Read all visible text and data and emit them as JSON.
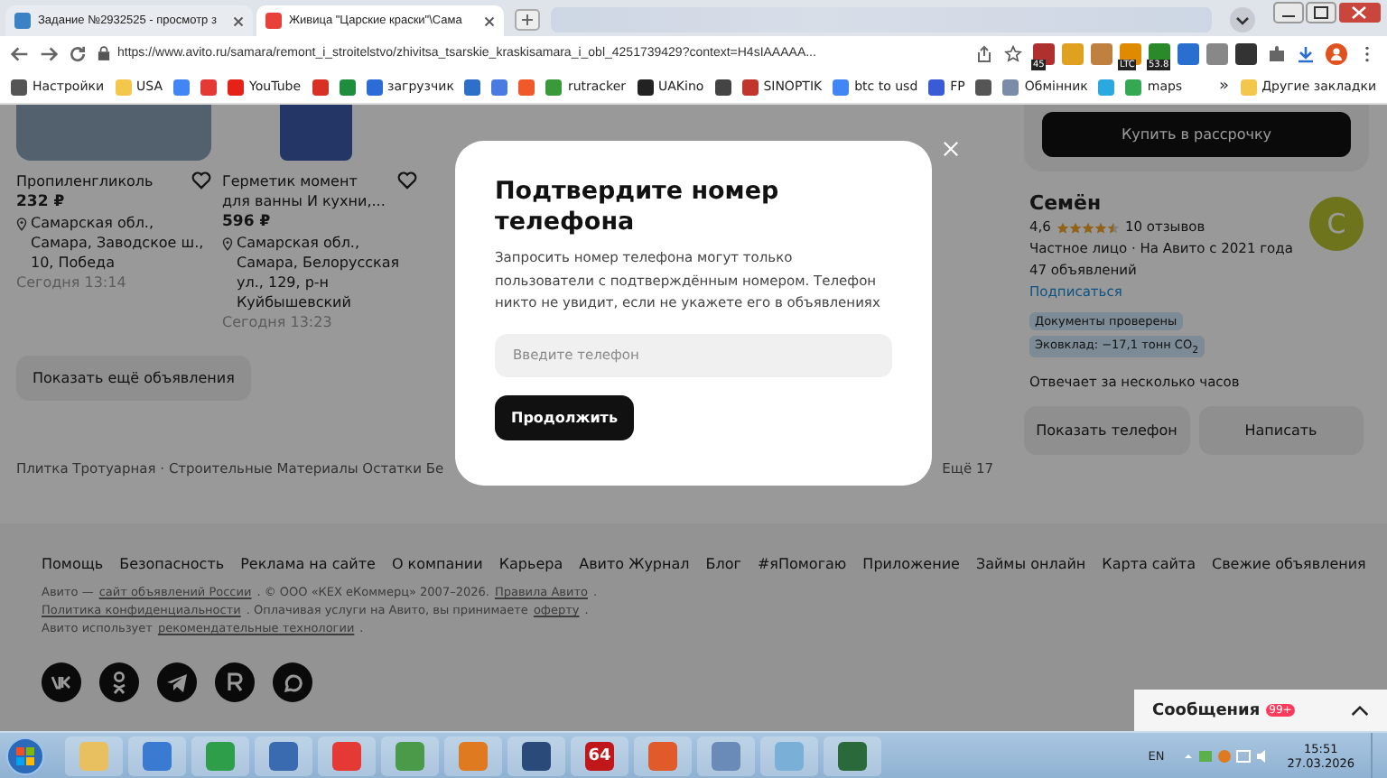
{
  "browser": {
    "tabs": [
      {
        "label": "Задание №2932525 - просмотр з",
        "selected": false,
        "color": "#3b82c4"
      },
      {
        "label": "Живица \"Царские краски\"\\Сама",
        "selected": true,
        "color": "#e8413c"
      }
    ],
    "url": "https://www.avito.ru/samara/remont_i_stroitelstvo/zhivitsa_tsarskie_kraskisamara_i_obl_4251739429?context=H4sIAAAAA...",
    "extensions": [
      {
        "color": "#b03030",
        "badge": "45"
      },
      {
        "color": "#e0a020"
      },
      {
        "color": "#c08040"
      },
      {
        "color": "#e08a00",
        "badge": "LTC"
      },
      {
        "color": "#2a8a2a",
        "badge": "53.8"
      },
      {
        "color": "#2a6fd0"
      },
      {
        "color": "#888888"
      },
      {
        "color": "#333333"
      }
    ],
    "bookmarks": [
      {
        "label": "Настройки",
        "color": "#555555"
      },
      {
        "label": "USA",
        "color": "#f3c74b"
      },
      {
        "color": "#4285f4"
      },
      {
        "color": "#e53935"
      },
      {
        "label": "YouTube",
        "color": "#e62117"
      },
      {
        "color": "#d93025"
      },
      {
        "color": "#1e8e3e"
      },
      {
        "label": "загрузчик",
        "color": "#2b6cd6"
      },
      {
        "color": "#2d6fc9"
      },
      {
        "color": "#4a7be0"
      },
      {
        "color": "#f0592a"
      },
      {
        "label": "rutracker",
        "color": "#3a9a3a"
      },
      {
        "label": "UAKino",
        "color": "#222222"
      },
      {
        "color": "#444444"
      },
      {
        "label": "SINOPTIK",
        "color": "#c0352c"
      },
      {
        "label": "btc to usd",
        "color": "#4285f4"
      },
      {
        "label": "FP",
        "color": "#3b5bd6"
      },
      {
        "color": "#555555"
      },
      {
        "label": "Обмінник",
        "color": "#7a8ca8"
      },
      {
        "color": "#2aa8e0"
      },
      {
        "label": "maps",
        "color": "#34a853"
      }
    ],
    "more": "»",
    "other_bookmarks": "Другие закладки"
  },
  "page": {
    "listings": [
      {
        "title": "Пропиленгликоль",
        "price": "232 ₽",
        "address": "Самарская обл., Самара, Заводское ш., 10, Победа",
        "date": "Сегодня 13:14"
      },
      {
        "title": "Герметик момент для ванны И кухни,...",
        "price": "596 ₽",
        "address": "Самарская обл., Самара, Белорусская ул., 129, р-н Куйбышевский",
        "date": "Сегодня 13:23"
      }
    ],
    "show_more": "Показать ещё объявления",
    "categories": "Плитка Тротуарная · Строительные Материалы Остатки Бе",
    "categories_more": "Ещё 17",
    "installment_button": "Купить в рассрочку",
    "seller": {
      "name": "Семён",
      "avatar_letter": "С",
      "rating": "4,6",
      "stars": 4.5,
      "reviews": "10 отзывов",
      "info": "Частное лицо · На Авито с 2021 года",
      "listings_count": "47 объявлений",
      "subscribe": "Подписаться",
      "tags": [
        "Документы проверены",
        "Эковклад: −17,1 тонн CO$_{2}$"
      ],
      "response": "Отвечает за несколько часов",
      "phone_button": "Показать телефон",
      "message_button": "Написать"
    },
    "footer": {
      "links": [
        "Помощь",
        "Безопасность",
        "Реклама на сайте",
        "О компании",
        "Карьера",
        "Авито Журнал",
        "Блог",
        "#яПомогаю",
        "Приложение",
        "Займы онлайн",
        "Карта сайта",
        "Свежие объявления"
      ],
      "legal": [
        [
          {
            "kind": "text",
            "text": "Авито —"
          },
          {
            "kind": "link",
            "text": "сайт объявлений России"
          },
          {
            "kind": "text",
            "text": ". © ООО «КЕХ еКоммерц» 2007–2026."
          },
          {
            "kind": "link",
            "text": "Правила Авито"
          },
          {
            "kind": "text",
            "text": "."
          }
        ],
        [
          {
            "kind": "link",
            "text": "Политика конфиденциальности"
          },
          {
            "kind": "text",
            "text": ". Оплачивая услуги на Авито, вы принимаете"
          },
          {
            "kind": "link",
            "text": "оферту"
          },
          {
            "kind": "text",
            "text": "."
          }
        ],
        [
          {
            "kind": "text",
            "text": "Авито использует"
          },
          {
            "kind": "link",
            "text": "рекомендательные технологии"
          },
          {
            "kind": "text",
            "text": "."
          }
        ]
      ]
    },
    "messages": {
      "label": "Сообщения",
      "badge": "99+"
    }
  },
  "modal": {
    "title": "Подтвердите номер телефона",
    "text": "Запросить номер телефона могут только пользователи с подтверждённым номером. Телефон никто не увидит, если не укажете его в объявлениях",
    "placeholder": "Введите телефон",
    "button": "Продолжить"
  },
  "taskbar": {
    "apps": [
      {
        "color": "#e8c060"
      },
      {
        "color": "#3a7ad0"
      },
      {
        "color": "#2e9e4a"
      },
      {
        "color": "#3a6ab0"
      },
      {
        "color": "#e53935"
      },
      {
        "color": "#4a9a4a"
      },
      {
        "color": "#e07a20"
      },
      {
        "color": "#2a4a7a"
      },
      {
        "color": "#c0181a",
        "label": "64"
      },
      {
        "color": "#e05a2a"
      },
      {
        "color": "#6a8ab8"
      },
      {
        "color": "#7ab0d8"
      },
      {
        "color": "#2a6a3a"
      }
    ],
    "language": "EN",
    "time": "15:51",
    "date": "27.03.2026"
  }
}
